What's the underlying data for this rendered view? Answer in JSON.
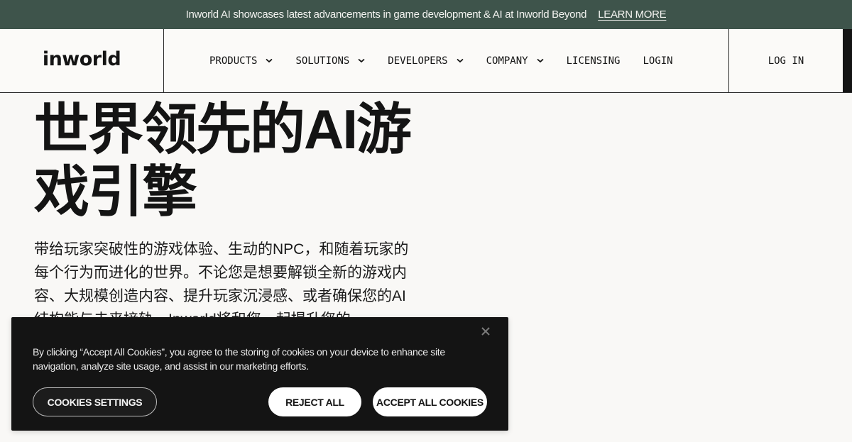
{
  "announcement": {
    "text": "Inworld AI showcases latest advancements in game development & AI at Inworld Beyond",
    "link_label": "LEARN MORE"
  },
  "header": {
    "logo_text": "inworld",
    "nav": [
      {
        "label": "PRODUCTS",
        "has_dropdown": true
      },
      {
        "label": "SOLUTIONS",
        "has_dropdown": true
      },
      {
        "label": "DEVELOPERS",
        "has_dropdown": true
      },
      {
        "label": "COMPANY",
        "has_dropdown": true
      },
      {
        "label": "LICENSING",
        "has_dropdown": false
      },
      {
        "label": "LOGIN",
        "has_dropdown": false
      }
    ],
    "login_button": "LOG IN"
  },
  "hero": {
    "title": "世界领先的AI游戏引擎",
    "description": "带给玩家突破性的游戏体验、生动的NPC，和随着玩家的每个行为而进化的世界。不论您是想要解锁全新的游戏内容、大规模创造内容、提升玩家沉浸感、或者确保您的AI结构能与未来接轨，Inworld将和您一起提升您的"
  },
  "cookie_banner": {
    "text": "By clicking “Accept All Cookies”, you agree to the storing of cookies on your device to enhance site navigation, analyze site usage, and assist in our marketing efforts.",
    "settings_label": "COOKIES SETTINGS",
    "reject_label": "REJECT ALL",
    "accept_label": "ACCEPT ALL COOKIES",
    "close_icon": "close-icon"
  }
}
